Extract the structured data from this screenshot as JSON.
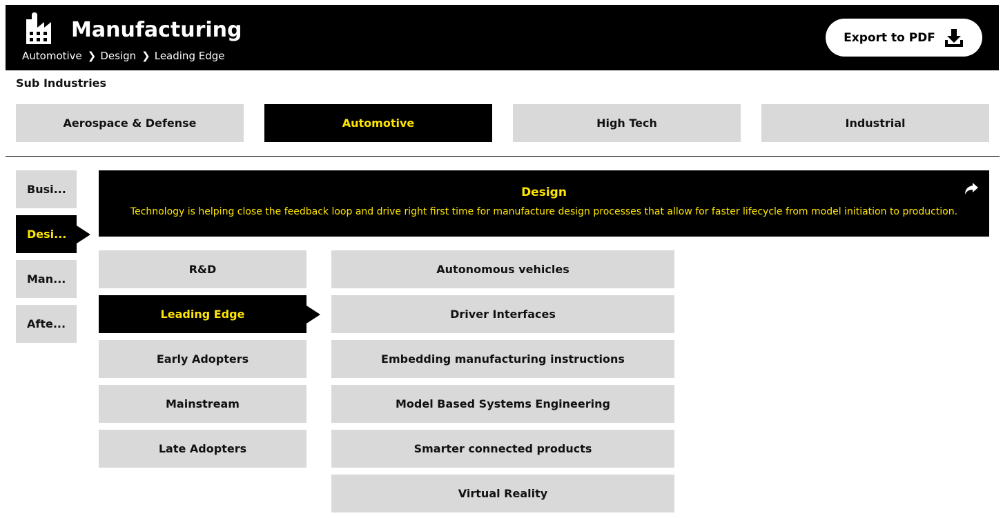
{
  "header": {
    "title": "Manufacturing",
    "breadcrumb": [
      "Automotive",
      "Design",
      "Leading Edge"
    ],
    "export_label": "Export to PDF"
  },
  "sub_industries": {
    "label": "Sub Industries",
    "tabs": [
      {
        "label": "Aerospace & Defense",
        "active": false
      },
      {
        "label": "Automotive",
        "active": true
      },
      {
        "label": "High Tech",
        "active": false
      },
      {
        "label": "Industrial",
        "active": false
      }
    ]
  },
  "side_menu": [
    {
      "label": "Busi...",
      "active": false
    },
    {
      "label": "Desi...",
      "active": true
    },
    {
      "label": "Man...",
      "active": false
    },
    {
      "label": "Afte...",
      "active": false
    }
  ],
  "description": {
    "title": "Design",
    "text": "Technology is helping close the feedback loop and drive right first time for manufacture design processes that allow for faster lifecycle from model initiation to production."
  },
  "stages": [
    {
      "label": "R&D",
      "active": false
    },
    {
      "label": "Leading Edge",
      "active": true
    },
    {
      "label": "Early Adopters",
      "active": false
    },
    {
      "label": "Mainstream",
      "active": false
    },
    {
      "label": "Late Adopters",
      "active": false
    }
  ],
  "technologies": [
    "Autonomous vehicles",
    "Driver Interfaces",
    "Embedding manufacturing instructions",
    "Model Based Systems Engineering",
    "Smarter connected products",
    "Virtual Reality"
  ],
  "colors": {
    "header_bg": "#000000",
    "accent": "#ffe600",
    "item_bg": "#d9d9d9"
  }
}
